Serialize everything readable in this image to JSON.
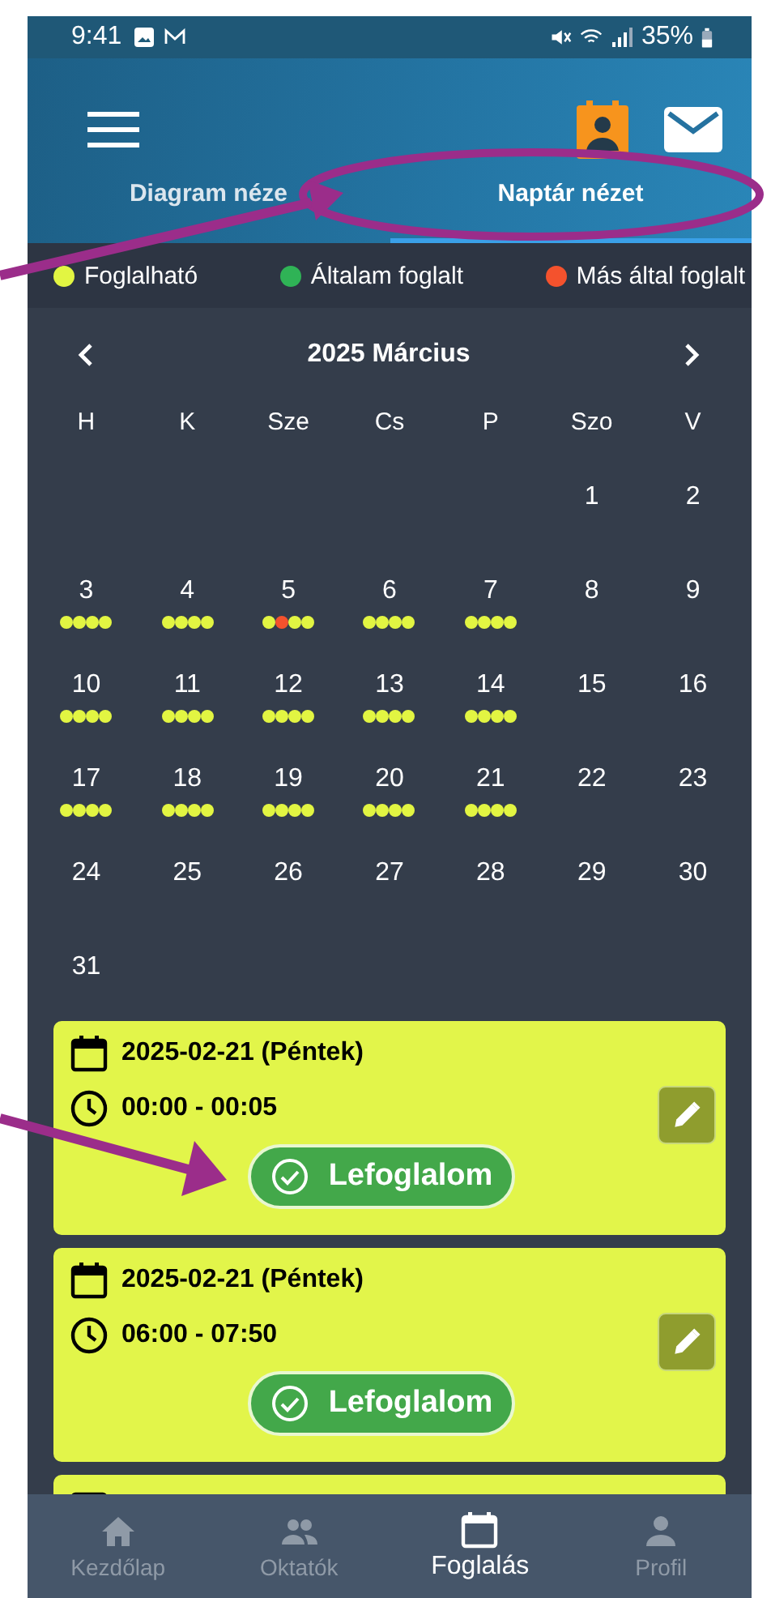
{
  "status_bar": {
    "time": "9:41",
    "battery": "35%"
  },
  "tabs": [
    {
      "label": "Diagram néze",
      "selected": false
    },
    {
      "label": "Naptár nézet",
      "selected": true
    }
  ],
  "legend": [
    {
      "label": "Foglalható",
      "color": "#e2f542"
    },
    {
      "label": "Általam foglalt",
      "color": "#2fb356"
    },
    {
      "label": "Más által foglalt",
      "color": "#f4522d"
    }
  ],
  "calendar": {
    "title": "2025 Március",
    "weekdays": [
      "H",
      "K",
      "Sze",
      "Cs",
      "P",
      "Szo",
      "V"
    ],
    "days": [
      {
        "kind": "blank"
      },
      {
        "kind": "blank"
      },
      {
        "kind": "blank"
      },
      {
        "kind": "blank"
      },
      {
        "kind": "blank"
      },
      {
        "kind": "day",
        "label": "1"
      },
      {
        "kind": "day",
        "label": "2"
      },
      {
        "kind": "day",
        "label": "3",
        "dots": [
          {
            "color": "#e2f542"
          },
          {
            "color": "#e2f542"
          },
          {
            "color": "#e2f542"
          },
          {
            "color": "#e2f542"
          }
        ]
      },
      {
        "kind": "day",
        "label": "4",
        "dots": [
          {
            "color": "#e2f542"
          },
          {
            "color": "#e2f542"
          },
          {
            "color": "#e2f542"
          },
          {
            "color": "#e2f542"
          }
        ]
      },
      {
        "kind": "day",
        "label": "5",
        "dots": [
          {
            "color": "#e2f542"
          },
          {
            "color": "#f4522d"
          },
          {
            "color": "#e2f542"
          },
          {
            "color": "#e2f542"
          }
        ]
      },
      {
        "kind": "day",
        "label": "6",
        "dots": [
          {
            "color": "#e2f542"
          },
          {
            "color": "#e2f542"
          },
          {
            "color": "#e2f542"
          },
          {
            "color": "#e2f542"
          }
        ]
      },
      {
        "kind": "day",
        "label": "7",
        "dots": [
          {
            "color": "#e2f542"
          },
          {
            "color": "#e2f542"
          },
          {
            "color": "#e2f542"
          },
          {
            "color": "#e2f542"
          }
        ]
      },
      {
        "kind": "day",
        "label": "8"
      },
      {
        "kind": "day",
        "label": "9"
      },
      {
        "kind": "day",
        "label": "10",
        "dots": [
          {
            "color": "#e2f542"
          },
          {
            "color": "#e2f542"
          },
          {
            "color": "#e2f542"
          },
          {
            "color": "#e2f542"
          }
        ]
      },
      {
        "kind": "day",
        "label": "11",
        "dots": [
          {
            "color": "#e2f542"
          },
          {
            "color": "#e2f542"
          },
          {
            "color": "#e2f542"
          },
          {
            "color": "#e2f542"
          }
        ]
      },
      {
        "kind": "day",
        "label": "12",
        "dots": [
          {
            "color": "#e2f542"
          },
          {
            "color": "#e2f542"
          },
          {
            "color": "#e2f542"
          },
          {
            "color": "#e2f542"
          }
        ]
      },
      {
        "kind": "day",
        "label": "13",
        "dots": [
          {
            "color": "#e2f542"
          },
          {
            "color": "#e2f542"
          },
          {
            "color": "#e2f542"
          },
          {
            "color": "#e2f542"
          }
        ]
      },
      {
        "kind": "day",
        "label": "14",
        "dots": [
          {
            "color": "#e2f542"
          },
          {
            "color": "#e2f542"
          },
          {
            "color": "#e2f542"
          },
          {
            "color": "#e2f542"
          }
        ]
      },
      {
        "kind": "day",
        "label": "15"
      },
      {
        "kind": "day",
        "label": "16"
      },
      {
        "kind": "day",
        "label": "17",
        "dots": [
          {
            "color": "#e2f542"
          },
          {
            "color": "#e2f542"
          },
          {
            "color": "#e2f542"
          },
          {
            "color": "#e2f542"
          }
        ]
      },
      {
        "kind": "day",
        "label": "18",
        "dots": [
          {
            "color": "#e2f542"
          },
          {
            "color": "#e2f542"
          },
          {
            "color": "#e2f542"
          },
          {
            "color": "#e2f542"
          }
        ]
      },
      {
        "kind": "day",
        "label": "19",
        "dots": [
          {
            "color": "#e2f542"
          },
          {
            "color": "#e2f542"
          },
          {
            "color": "#e2f542"
          },
          {
            "color": "#e2f542"
          }
        ]
      },
      {
        "kind": "day",
        "label": "20",
        "dots": [
          {
            "color": "#e2f542"
          },
          {
            "color": "#e2f542"
          },
          {
            "color": "#e2f542"
          },
          {
            "color": "#e2f542"
          }
        ]
      },
      {
        "kind": "day",
        "label": "21",
        "dots": [
          {
            "color": "#e2f542"
          },
          {
            "color": "#e2f542"
          },
          {
            "color": "#e2f542"
          },
          {
            "color": "#e2f542"
          }
        ]
      },
      {
        "kind": "day",
        "label": "22"
      },
      {
        "kind": "day",
        "label": "23"
      },
      {
        "kind": "day",
        "label": "24"
      },
      {
        "kind": "day",
        "label": "25"
      },
      {
        "kind": "day",
        "label": "26"
      },
      {
        "kind": "day",
        "label": "27"
      },
      {
        "kind": "day",
        "label": "28"
      },
      {
        "kind": "day",
        "label": "29"
      },
      {
        "kind": "day",
        "label": "30"
      },
      {
        "kind": "day",
        "label": "31"
      }
    ]
  },
  "slots": [
    {
      "kind": "full",
      "date": "2025-02-21 (Péntek)",
      "time": "00:00 - 00:05",
      "button": "Lefoglalom"
    },
    {
      "kind": "full",
      "date": "2025-02-21 (Péntek)",
      "time": "06:00 - 07:50",
      "button": "Lefoglalom"
    },
    {
      "kind": "partial"
    }
  ],
  "bottom_nav": [
    {
      "label": "Kezdőlap",
      "selected": false
    },
    {
      "label": "Oktatók",
      "selected": false
    },
    {
      "label": "Foglalás",
      "selected": true
    },
    {
      "label": "Profil",
      "selected": false
    }
  ]
}
